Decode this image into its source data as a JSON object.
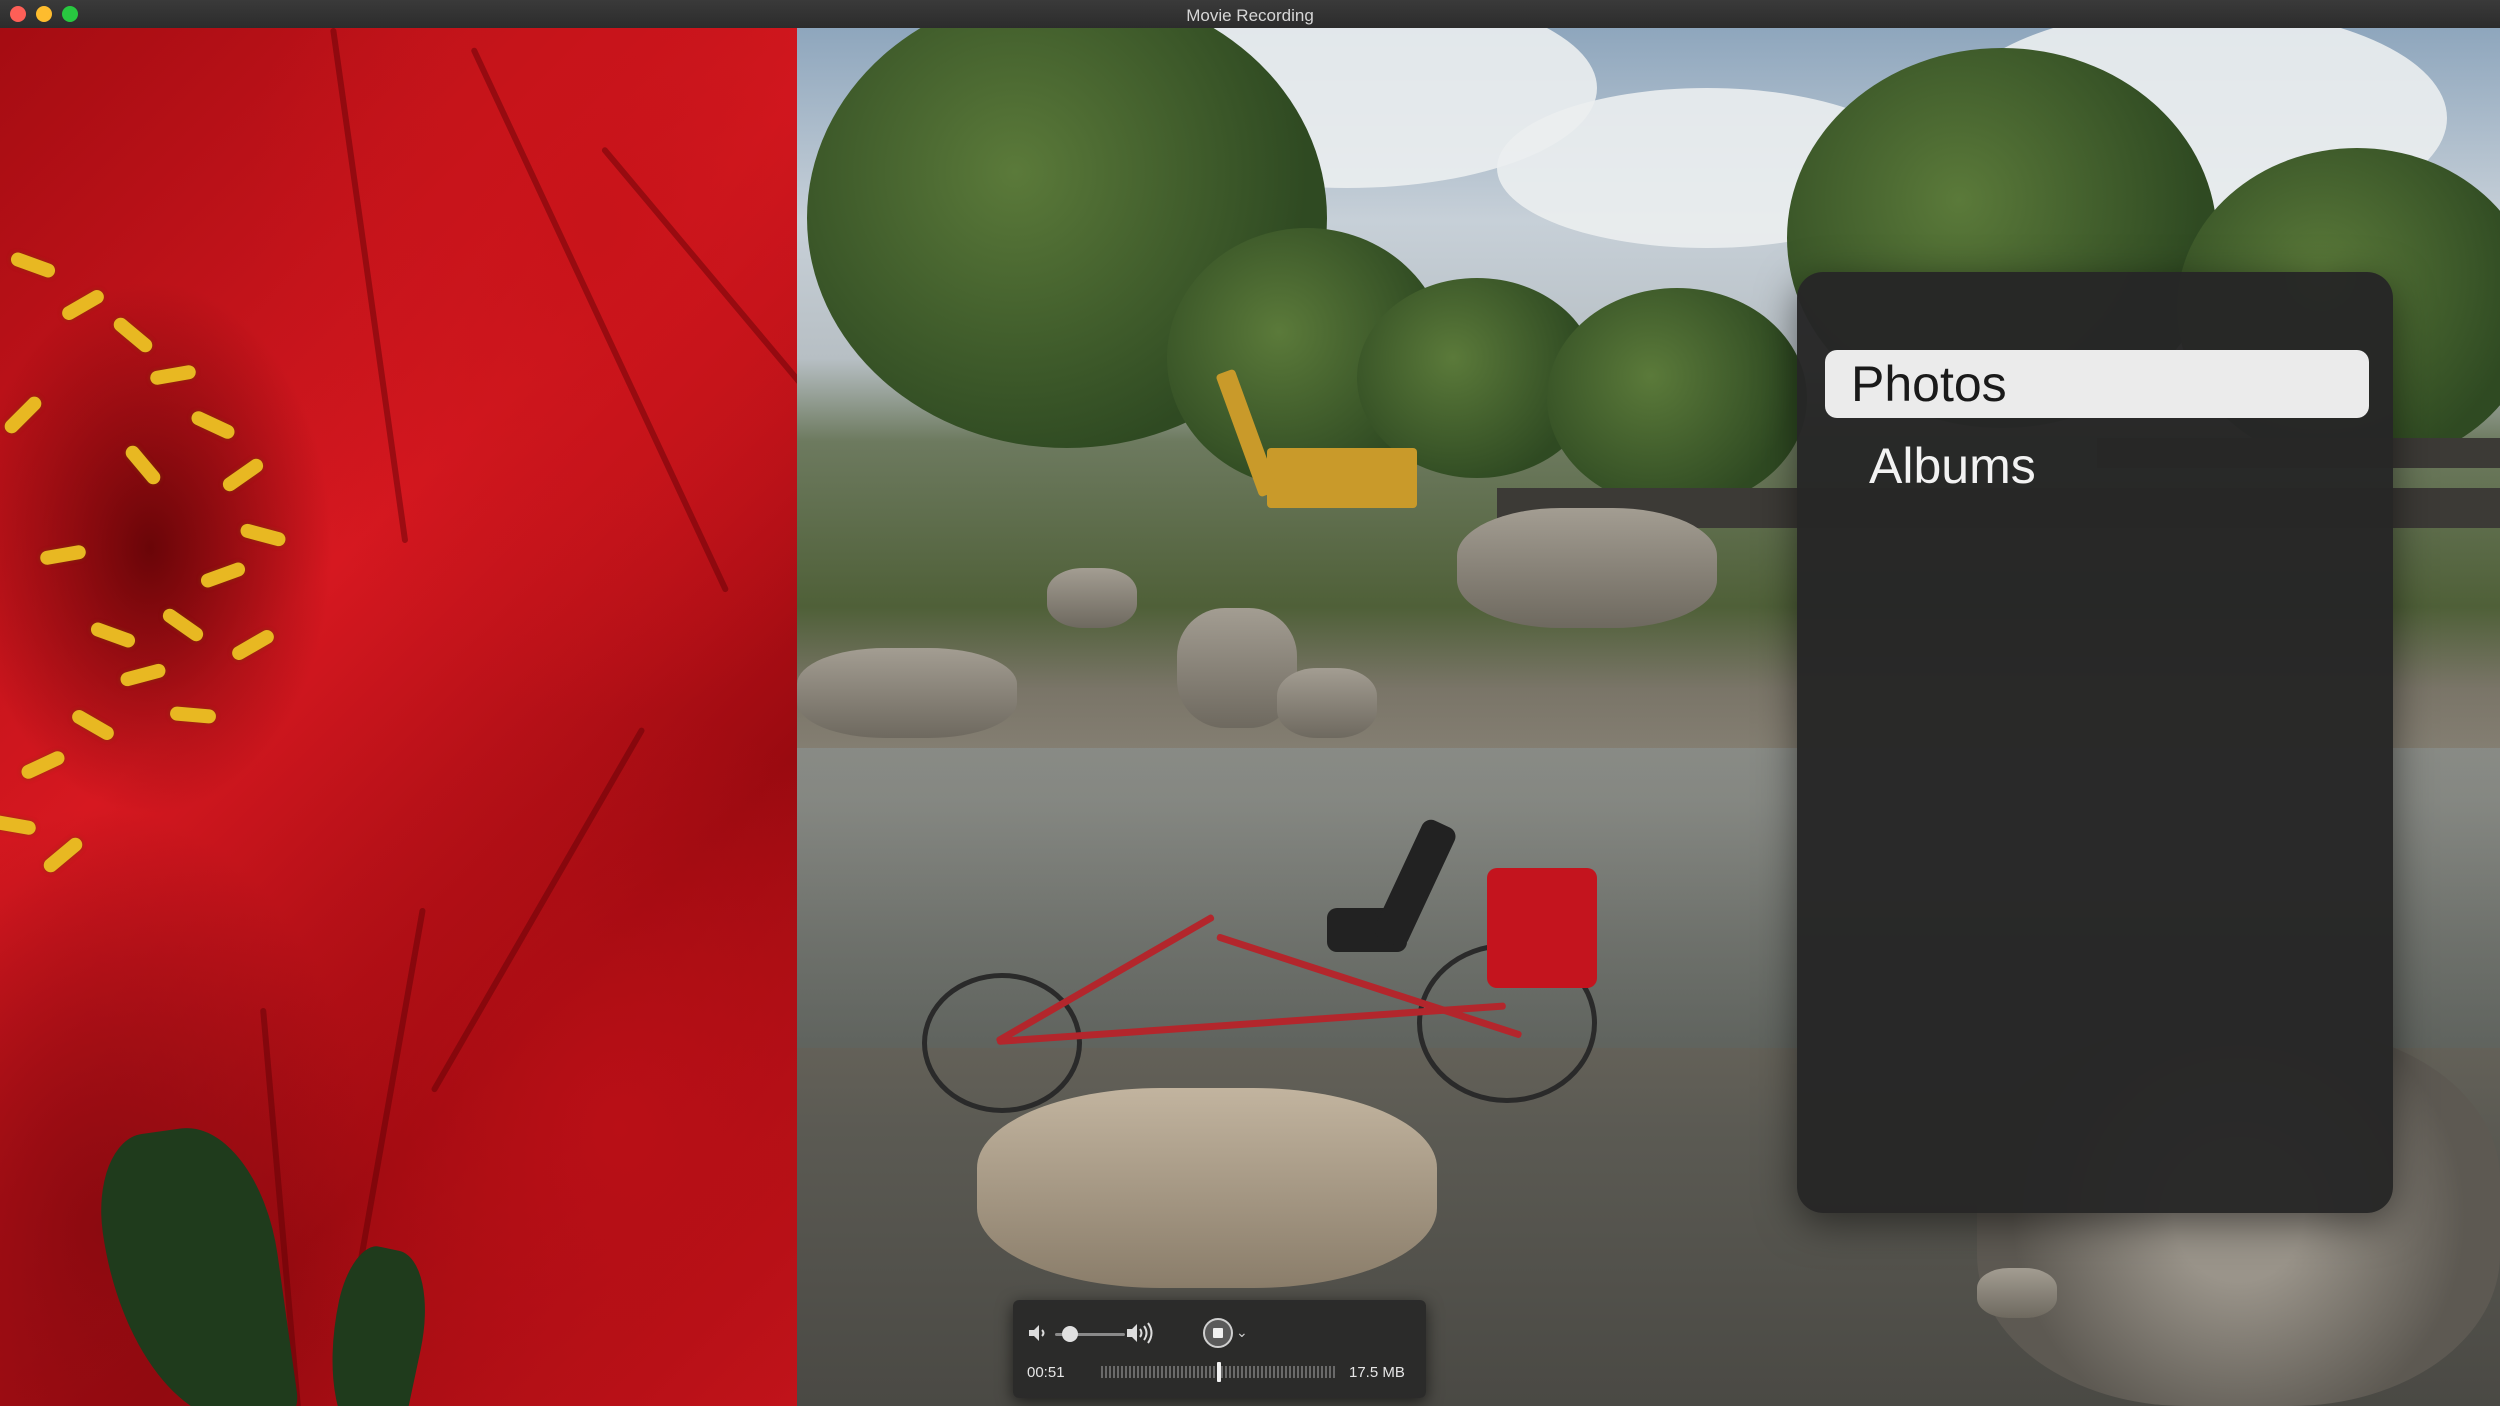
{
  "window": {
    "title": "Movie Recording"
  },
  "menu": {
    "items": [
      {
        "label": "Photos",
        "selected": true
      },
      {
        "label": "Albums",
        "selected": false
      }
    ]
  },
  "hud": {
    "elapsed": "00:51",
    "file_size": "17.5 MB",
    "volume_level": 0.1
  },
  "icons": {
    "volume_low": "speaker-low-icon",
    "volume_high": "speaker-high-icon",
    "stop": "stop-record-icon",
    "options": "chevron-down-icon"
  },
  "colors": {
    "traffic_close": "#fe5f57",
    "traffic_min": "#febc2e",
    "traffic_max": "#28c840",
    "menu_selected_bg": "#ebebeb",
    "menu_panel_bg": "#262626"
  }
}
